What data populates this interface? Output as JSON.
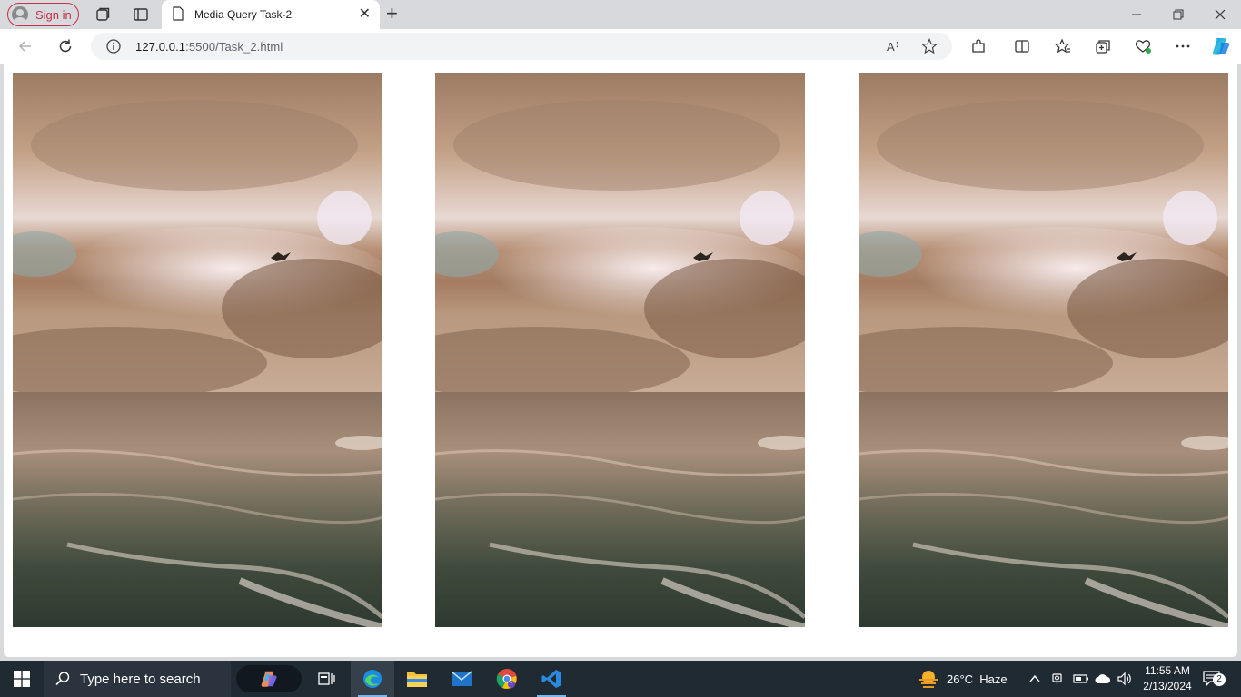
{
  "browser": {
    "signin_label": "Sign in",
    "tab_title": "Media Query Task-2",
    "url_host": "127.0.0.1",
    "url_rest": ":5500/Task_2.html",
    "icons": [
      "workspaces-icon",
      "vertical-tabs-icon",
      "page-icon",
      "close-tab-icon",
      "new-tab-icon",
      "minimize-icon",
      "restore-icon",
      "close-window-icon",
      "back-icon",
      "refresh-icon",
      "info-icon",
      "read-aloud-icon",
      "favorite-star-icon",
      "extensions-icon",
      "split-screen-icon",
      "favorites-icon",
      "collections-icon",
      "browser-essentials-icon",
      "more-icon",
      "copilot-icon"
    ]
  },
  "page": {
    "images": [
      {
        "alt": "Cloudy sky over ocean with bird"
      },
      {
        "alt": "Cloudy sky over ocean with bird"
      },
      {
        "alt": "Cloudy sky over ocean with bird"
      }
    ]
  },
  "taskbar": {
    "search_placeholder": "Type here to search",
    "weather": "26°C  Haze",
    "time": "11:55 AM",
    "date": "2/13/2024",
    "notification_count": "2",
    "apps": [
      "task-view-icon",
      "edge-icon",
      "file-explorer-icon",
      "mail-icon",
      "chrome-icon",
      "vscode-icon"
    ]
  },
  "colors": {
    "signin_accent": "#c4314b",
    "taskbar_bg": "#202a33",
    "chrome_bg": "#d7d9dc"
  }
}
